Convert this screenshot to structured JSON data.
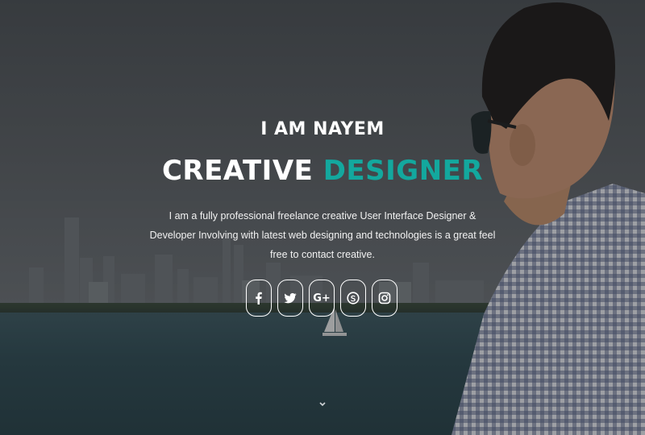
{
  "hero": {
    "intro": "I AM NAYEM",
    "headline_main": "CREATIVE",
    "headline_accent": "DESIGNER",
    "description": "I am a fully professional freelance creative User Interface Designer & Developer Involving with latest web designing and technologies is a great feel free to contact creative.",
    "accent_color": "#13a89e"
  },
  "social": [
    {
      "name": "facebook",
      "icon": "facebook-icon"
    },
    {
      "name": "twitter",
      "icon": "twitter-icon"
    },
    {
      "name": "google-plus",
      "icon": "google-plus-icon",
      "label": "G+"
    },
    {
      "name": "skype",
      "icon": "skype-icon"
    },
    {
      "name": "instagram",
      "icon": "instagram-icon"
    }
  ],
  "scroll_indicator": {
    "icon": "chevron-down-icon"
  }
}
